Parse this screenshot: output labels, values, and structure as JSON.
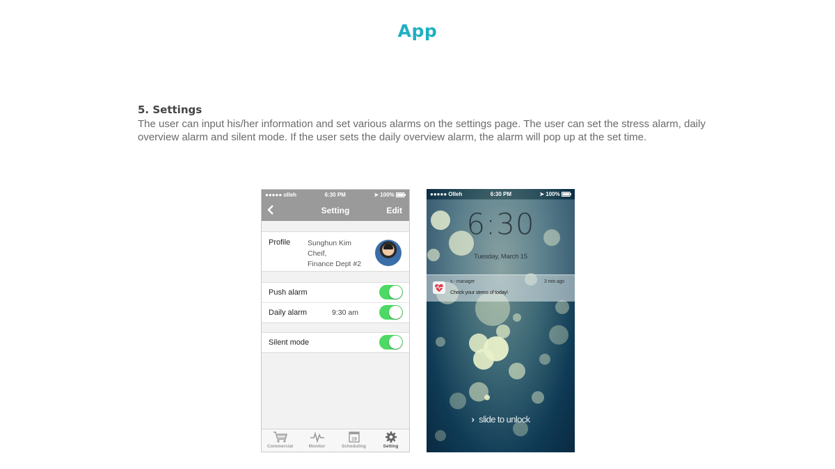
{
  "page": {
    "title": "App",
    "section_heading": "5. Settings",
    "section_body": "The user can input his/her information and set various alarms on the settings page. The user can set the stress alarm, daily overview alarm and silent mode. If the user sets the daily overview alarm, the alarm will pop up at the set time.",
    "accent_color": "#1fb0c2"
  },
  "settings_screen": {
    "status": {
      "carrier": "●●●●● olleh",
      "time": "6:30 PM",
      "battery": "100%"
    },
    "nav": {
      "back_icon": "chevron-left-icon",
      "title": "Setting",
      "edit_label": "Edit"
    },
    "profile": {
      "label": "Profile",
      "name": "Sunghun Kim",
      "role": "Cheif,",
      "dept": "Finance Dept #2"
    },
    "rows": {
      "push_alarm": {
        "label": "Push alarm",
        "on": true
      },
      "daily_alarm": {
        "label": "Daily alarm",
        "value": "9:30 am",
        "on": true
      },
      "silent_mode": {
        "label": "Silent mode",
        "on": true
      }
    },
    "toggle_color": "#4cd964",
    "tabs": [
      {
        "label": "Commercial",
        "icon": "cart-icon"
      },
      {
        "label": "Monitor",
        "icon": "pulse-icon"
      },
      {
        "label": "Scheduling",
        "icon": "calendar-icon",
        "calendar_day": "19"
      },
      {
        "label": "Setting",
        "icon": "gear-icon",
        "active": true
      }
    ]
  },
  "lock_screen": {
    "status": {
      "carrier": "●●●●● Olleh",
      "time": "6:30 PM",
      "battery": "100%"
    },
    "time": "6:30",
    "date": "Tuesday, March 15",
    "notification": {
      "app": "s - manager",
      "time_ago": "3 min ago",
      "message": "Check your stress of today!",
      "icon": "heart-pulse-icon"
    },
    "unlock_text": "slide to unlock"
  }
}
